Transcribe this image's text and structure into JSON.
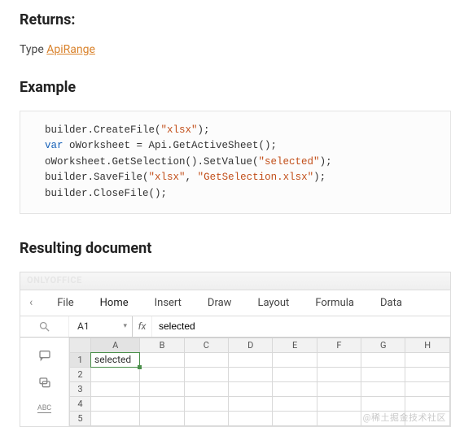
{
  "headings": {
    "returns": "Returns:",
    "example": "Example",
    "resulting": "Resulting document"
  },
  "type_line": {
    "prefix": "Type ",
    "link": "ApiRange"
  },
  "code": {
    "l1a": "builder.CreateFile(",
    "l1s": "\"xlsx\"",
    "l1b": ");",
    "l2k": "var",
    "l2a": " oWorksheet = Api.GetActiveSheet();",
    "l3a": "oWorksheet.GetSelection().SetValue(",
    "l3s": "\"selected\"",
    "l3b": ");",
    "l4a": "builder.SaveFile(",
    "l4s1": "\"xlsx\"",
    "l4m": ", ",
    "l4s2": "\"GetSelection.xlsx\"",
    "l4b": ");",
    "l5": "builder.CloseFile();"
  },
  "ss": {
    "logo": "ONLYOFFICE",
    "tabs": [
      "File",
      "Home",
      "Insert",
      "Draw",
      "Layout",
      "Formula",
      "Data"
    ],
    "chev": "‹",
    "namebox": "A1",
    "fx_label": "fx",
    "fx_value": "selected",
    "cols": [
      "A",
      "B",
      "C",
      "D",
      "E",
      "F",
      "G",
      "H"
    ],
    "rows": [
      "1",
      "2",
      "3",
      "4",
      "5"
    ],
    "cell_a1": "selected",
    "abc": "ABC"
  },
  "watermark": "@稀土掘金技术社区"
}
